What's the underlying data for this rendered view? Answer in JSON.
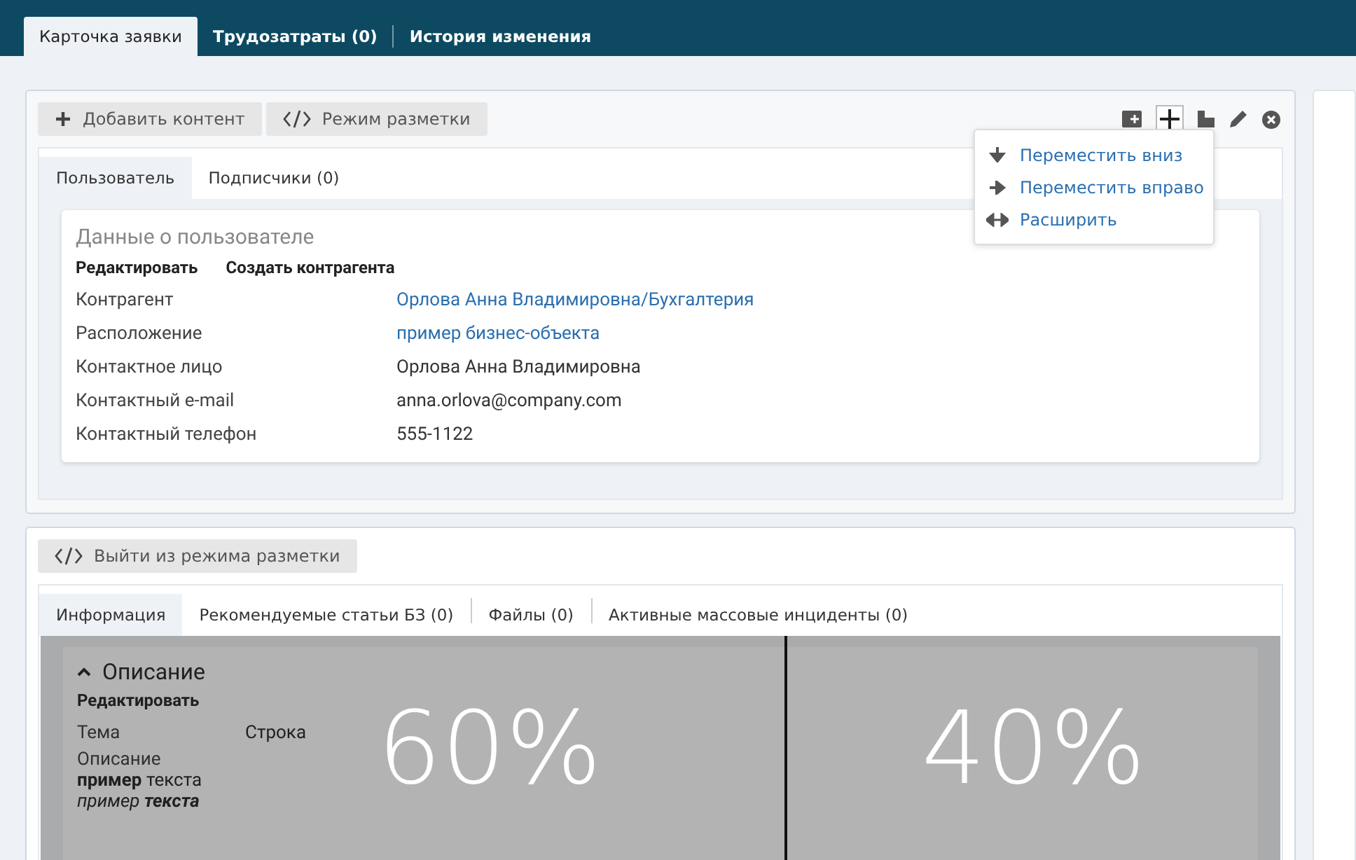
{
  "top_tabs": [
    {
      "label": "Карточка заявки",
      "selected": true
    },
    {
      "label": "Трудозатраты (0)",
      "selected": false
    },
    {
      "label": "История изменения",
      "selected": false
    }
  ],
  "panel1": {
    "buttons": [
      {
        "label": "Добавить контент",
        "kind": "add"
      },
      {
        "label": "Режим разметки",
        "kind": "code"
      }
    ],
    "menu": [
      {
        "label": "Переместить вниз",
        "kind": "down"
      },
      {
        "label": "Переместить вправо",
        "kind": "right"
      },
      {
        "label": "Расширить",
        "kind": "widen"
      }
    ],
    "tabs": [
      {
        "label": "Пользователь",
        "selected": true
      },
      {
        "label": "Подписчики (0)",
        "selected": false
      }
    ],
    "card": {
      "title": "Данные о пользователе",
      "actions": [
        "Редактировать",
        "Создать контрагента"
      ],
      "fields": [
        {
          "label": "Контрагент",
          "value": "Орлова Анна Владимировна/Бухгалтерия",
          "kind": "link"
        },
        {
          "label": "Расположение",
          "value": "пример бизнес-объекта",
          "kind": "link"
        },
        {
          "label": "Контактное лицо",
          "value": "Орлова Анна Владимировна",
          "kind": "text"
        },
        {
          "label": "Контактный e-mail",
          "value": "anna.orlova@company.com",
          "kind": "text"
        },
        {
          "label": "Контактный телефон",
          "value": "555-1122",
          "kind": "text"
        }
      ]
    }
  },
  "panel2": {
    "button": "Выйти из режима разметки",
    "tabs": [
      {
        "label": "Информация",
        "selected": true
      },
      {
        "label": "Рекомендуемые статьи БЗ (0)",
        "selected": false
      },
      {
        "label": "Файлы (0)",
        "selected": false
      },
      {
        "label": "Активные массовые инциденты (0)",
        "selected": false
      }
    ],
    "section": {
      "title": "Описание",
      "expanded": true,
      "action": "Редактировать",
      "topic_label": "Тема",
      "topic_value": "Строка",
      "desc_label": "Описание",
      "desc_lines": [
        {
          "text": "**пример** текста",
          "italic": false
        },
        {
          "text": "пример **текста**",
          "italic": true
        }
      ]
    },
    "columns": [
      {
        "label": "60%",
        "level": 0.6
      },
      {
        "label": "40%",
        "level": 0.4
      }
    ]
  }
}
